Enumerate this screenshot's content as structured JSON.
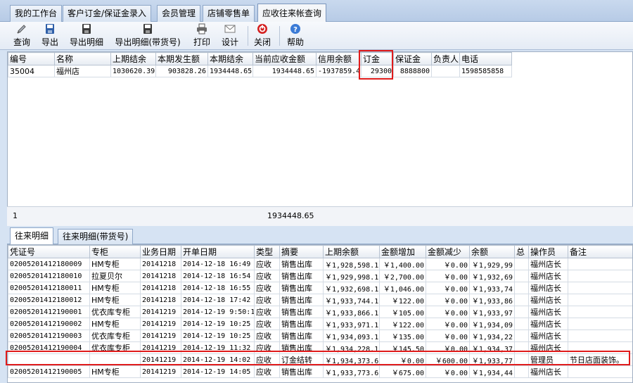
{
  "tabs": [
    "我的工作台",
    "客户订金/保证金录入",
    "会员管理",
    "店铺零售单",
    "应收往来帐查询"
  ],
  "active_tab_index": 4,
  "toolbar": [
    {
      "label": "查询",
      "icon": "search-icon"
    },
    {
      "label": "导出",
      "icon": "export-icon"
    },
    {
      "label": "导出明细",
      "icon": "export-detail-icon"
    },
    {
      "label": "导出明细(带货号)",
      "icon": "export-detail-sku-icon"
    },
    {
      "label": "打印",
      "icon": "printer-icon"
    },
    {
      "label": "设计",
      "icon": "design-icon"
    },
    {
      "label": "关闭",
      "icon": "close-icon"
    },
    {
      "label": "帮助",
      "icon": "help-icon"
    }
  ],
  "summary_table": {
    "headers": [
      "编号",
      "名称",
      "上期结余",
      "本期发生额",
      "本期结余",
      "当前应收金额",
      "信用余额",
      "订金",
      "保证金",
      "负责人",
      "电话"
    ],
    "rows": [
      [
        "35004",
        "福州店",
        "1030620.39",
        "903828.26",
        "1934448.65",
        "1934448.65",
        "-1937859.4",
        "29300",
        "8888800",
        "",
        "1598585858"
      ]
    ],
    "footer_count": "1",
    "footer_total": "1934448.65"
  },
  "detail_tabs": [
    "往来明细",
    "往来明细(带货号)"
  ],
  "active_detail_tab_index": 0,
  "detail_table": {
    "headers": [
      "凭证号",
      "专柜",
      "业务日期",
      "开单日期",
      "类型",
      "摘要",
      "上期余额",
      "金额增加",
      "金额减少",
      "余额",
      "总",
      "操作员",
      "备注"
    ],
    "rows": [
      [
        "02005201412180009",
        "HM专柜",
        "20141218",
        "2014-12-18 16:49",
        "应收",
        "销售出库",
        "￥1,928,598.1",
        "￥1,400.00",
        "￥0.00",
        "￥1,929,99",
        "",
        "福州店长",
        ""
      ],
      [
        "02005201412180010",
        "拉夏贝尔",
        "20141218",
        "2014-12-18 16:54",
        "应收",
        "销售出库",
        "￥1,929,998.1",
        "￥2,700.00",
        "￥0.00",
        "￥1,932,69",
        "",
        "福州店长",
        ""
      ],
      [
        "02005201412180011",
        "HM专柜",
        "20141218",
        "2014-12-18 16:55",
        "应收",
        "销售出库",
        "￥1,932,698.1",
        "￥1,046.00",
        "￥0.00",
        "￥1,933,74",
        "",
        "福州店长",
        ""
      ],
      [
        "02005201412180012",
        "HM专柜",
        "20141218",
        "2014-12-18 17:42",
        "应收",
        "销售出库",
        "￥1,933,744.1",
        "￥122.00",
        "￥0.00",
        "￥1,933,86",
        "",
        "福州店长",
        ""
      ],
      [
        "02005201412190001",
        "优衣库专柜",
        "20141219",
        "2014-12-19 9:50:1",
        "应收",
        "销售出库",
        "￥1,933,866.1",
        "￥105.00",
        "￥0.00",
        "￥1,933,97",
        "",
        "福州店长",
        ""
      ],
      [
        "02005201412190002",
        "HM专柜",
        "20141219",
        "2014-12-19 10:25",
        "应收",
        "销售出库",
        "￥1,933,971.1",
        "￥122.00",
        "￥0.00",
        "￥1,934,09",
        "",
        "福州店长",
        ""
      ],
      [
        "02005201412190003",
        "优衣库专柜",
        "20141219",
        "2014-12-19 10:25",
        "应收",
        "销售出库",
        "￥1,934,093.1",
        "￥135.00",
        "￥0.00",
        "￥1,934,22",
        "",
        "福州店长",
        ""
      ],
      [
        "02005201412190004",
        "优衣库专柜",
        "20141219",
        "2014-12-19 11:32",
        "应收",
        "销售出库",
        "￥1,934,228.1",
        "￥145.50",
        "￥0.00",
        "￥1,934,37",
        "",
        "福州店长",
        ""
      ],
      [
        "",
        "",
        "20141219",
        "2014-12-19 14:02",
        "应收",
        "订金结转",
        "￥1,934,373.6",
        "￥0.00",
        "￥600.00",
        "￥1,933,77",
        "",
        "管理员",
        "节日店面装饰。"
      ],
      [
        "02005201412190005",
        "HM专柜",
        "20141219",
        "2014-12-19 14:05",
        "应收",
        "销售出库",
        "￥1,933,773.6",
        "￥675.00",
        "￥0.00",
        "￥1,934,44",
        "",
        "福州店长",
        ""
      ]
    ]
  },
  "highlight_color": "#e01b1b"
}
